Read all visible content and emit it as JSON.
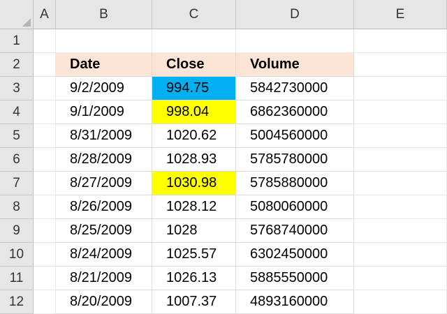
{
  "columns": [
    "A",
    "B",
    "C",
    "D",
    "E"
  ],
  "rows": [
    "1",
    "2",
    "3",
    "4",
    "5",
    "6",
    "7",
    "8",
    "9",
    "10",
    "11",
    "12"
  ],
  "table": {
    "headers": [
      "Date",
      "Close",
      "Volume"
    ],
    "rows": [
      [
        "9/2/2009",
        "994.75",
        "5842730000"
      ],
      [
        "9/1/2009",
        "998.04",
        "6862360000"
      ],
      [
        "8/31/2009",
        "1020.62",
        "5004560000"
      ],
      [
        "8/28/2009",
        "1028.93",
        "5785780000"
      ],
      [
        "8/27/2009",
        "1030.98",
        "5785880000"
      ],
      [
        "8/26/2009",
        "1028.12",
        "5080060000"
      ],
      [
        "8/25/2009",
        "1028",
        "5768740000"
      ],
      [
        "8/24/2009",
        "1025.57",
        "6302450000"
      ],
      [
        "8/21/2009",
        "1026.13",
        "5885550000"
      ],
      [
        "8/20/2009",
        "1007.37",
        "4893160000"
      ]
    ]
  },
  "fills": {
    "header": "#fce4d6",
    "highlight_blue": "#00b0f0",
    "highlight_yellow": "#ffff00",
    "highlighted_cells": [
      {
        "row": 3,
        "col": "C",
        "color": "#00b0f0"
      },
      {
        "row": 4,
        "col": "C",
        "color": "#ffff00"
      },
      {
        "row": 7,
        "col": "C",
        "color": "#ffff00"
      }
    ]
  }
}
